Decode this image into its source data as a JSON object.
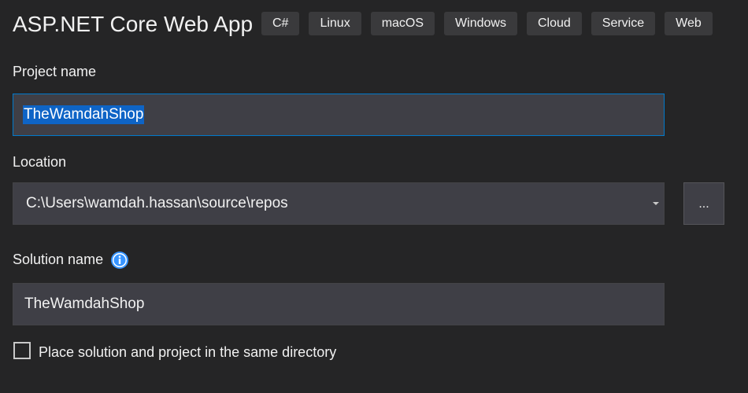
{
  "header": {
    "title": "ASP.NET Core Web App",
    "tags": [
      "C#",
      "Linux",
      "macOS",
      "Windows",
      "Cloud",
      "Service",
      "Web"
    ]
  },
  "project_name": {
    "label": "Project name",
    "value": "TheWamdahShop"
  },
  "location": {
    "label": "Location",
    "value": "C:\\Users\\wamdah.hassan\\source\\repos",
    "browse_label": "..."
  },
  "solution_name": {
    "label": "Solution name",
    "value": "TheWamdahShop",
    "info_icon": "info-icon"
  },
  "same_directory": {
    "label": "Place solution and project in the same directory",
    "checked": false
  },
  "colors": {
    "background": "#252526",
    "field_background": "#3f3f46",
    "focus_border": "#007acc",
    "selection": "#0e64c6",
    "info_icon": "#3794ff"
  }
}
